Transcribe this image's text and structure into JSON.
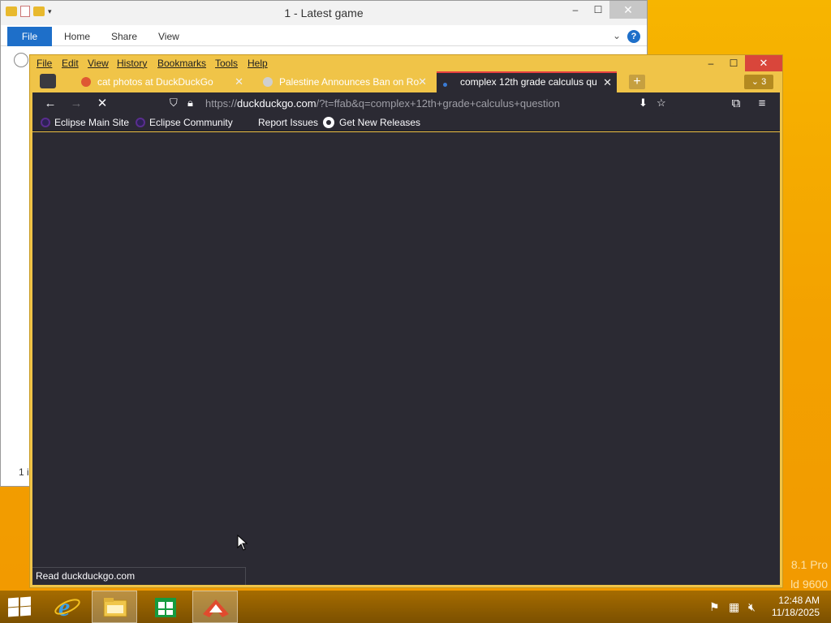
{
  "explorer": {
    "title": "1 - Latest game",
    "ribbon_tabs": [
      "File",
      "Home",
      "Share",
      "View"
    ],
    "help_label": "?",
    "status_text": "1 i"
  },
  "firefox": {
    "menu": [
      "File",
      "Edit",
      "View",
      "History",
      "Bookmarks",
      "Tools",
      "Help"
    ],
    "window_controls": {
      "minimize": "–",
      "maximize": "☐",
      "close": "✕"
    },
    "tabs": [
      {
        "title": "cat photos at DuckDuckGo",
        "active": false,
        "favicon_color": "#de5833"
      },
      {
        "title": "Palestine Announces Ban on Ro",
        "active": false,
        "favicon_color": "#cfcfcf"
      },
      {
        "title": "complex 12th grade calculus qu",
        "active": true,
        "favicon_color": "#3a7bd5"
      }
    ],
    "new_tab_label": "+",
    "tab_count": "3",
    "url_scheme_prefix": "https://",
    "url_host": "duckduckgo.com",
    "url_rest": "/?t=ffab&q=complex+12th+grade+calculus+question",
    "bookmarks": [
      {
        "label": "Eclipse Main Site",
        "icon": "eclipse-icon"
      },
      {
        "label": "Eclipse Community",
        "icon": "eclipse-icon"
      },
      {
        "label": "Report Issues",
        "icon": "none"
      },
      {
        "label": "Get New Releases",
        "icon": "github-icon"
      }
    ],
    "status_text": "Read duckduckgo.com"
  },
  "desktop": {
    "watermark_line1": "8.1 Pro",
    "watermark_line2": "ld 9600"
  },
  "taskbar": {
    "items": [
      "start-icon",
      "internet-explorer-icon",
      "file-explorer-icon",
      "store-icon",
      "firefox-icon"
    ],
    "clock_time": "12:48 AM",
    "clock_date": "11/18/2025"
  },
  "colors": {
    "firefox_chrome": "#f0c448",
    "firefox_dark": "#2b2a33",
    "active_tab_accent": "#e64040",
    "desktop": "#f3a100"
  }
}
